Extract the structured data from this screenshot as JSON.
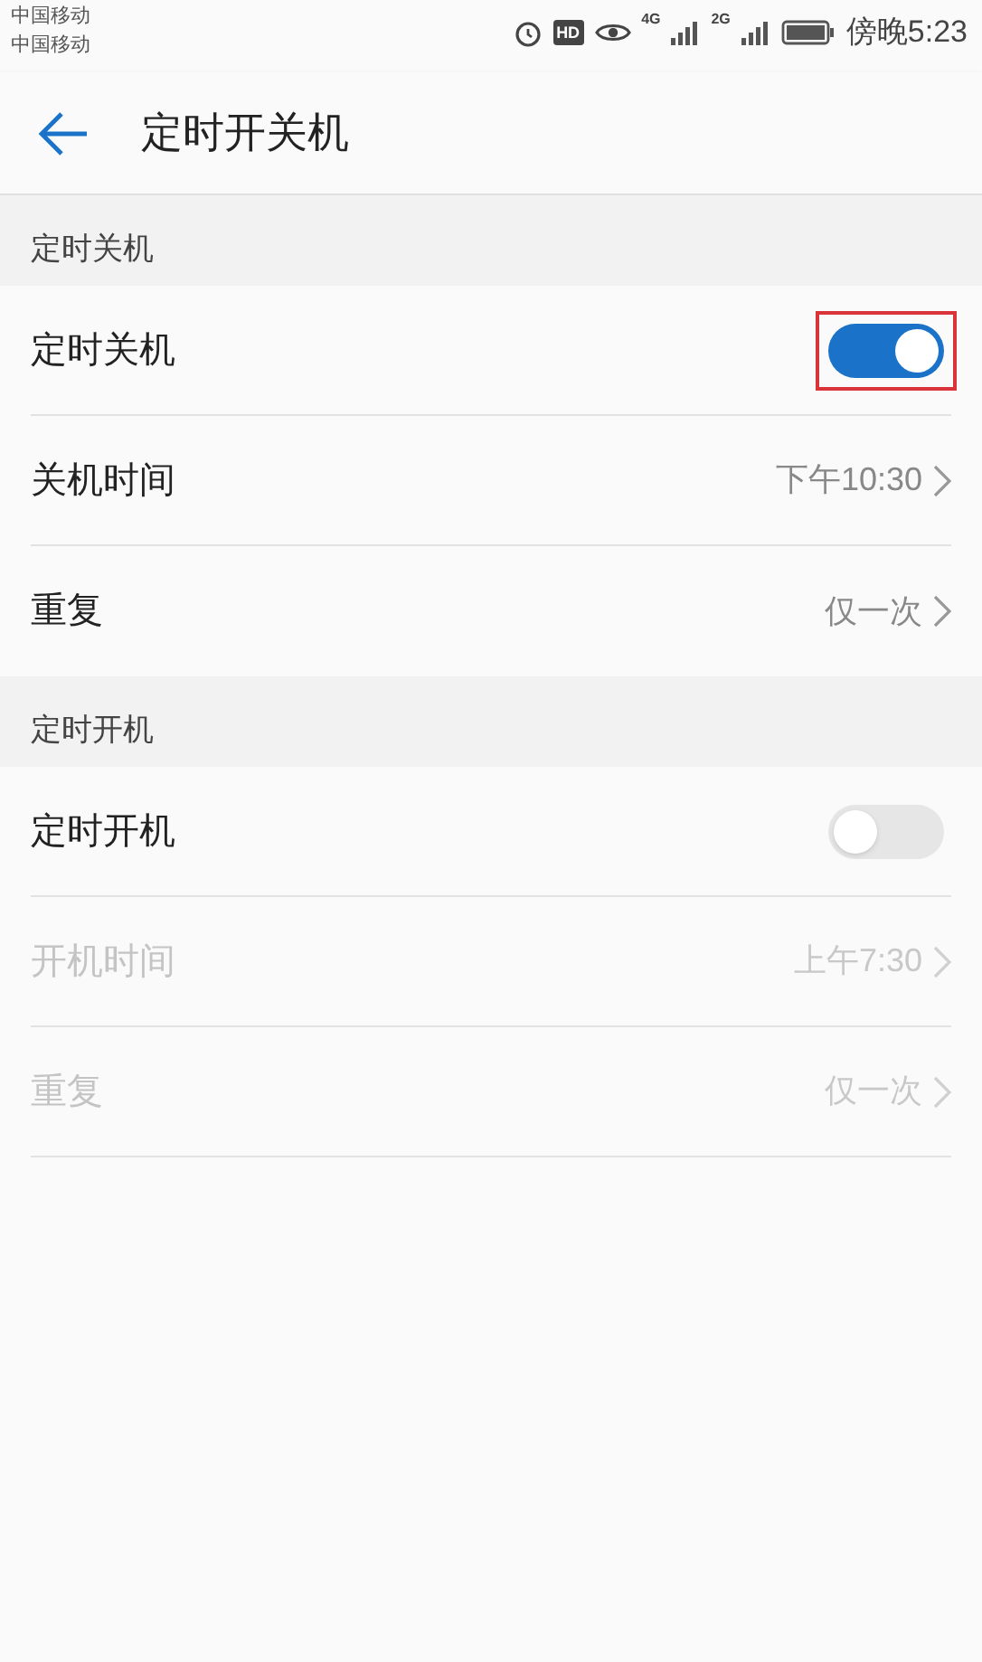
{
  "status_bar": {
    "carriers": [
      "中国移动",
      "中国移动"
    ],
    "hd": "HD",
    "net1": "4G",
    "net2": "2G",
    "time": "傍晚5:23"
  },
  "header": {
    "title": "定时开关机"
  },
  "sections": [
    {
      "title": "定时关机",
      "rows": [
        {
          "kind": "switch",
          "label": "定时关机",
          "on": true,
          "highlighted": true
        },
        {
          "kind": "value",
          "label": "关机时间",
          "value": "下午10:30",
          "disabled": false
        },
        {
          "kind": "value",
          "label": "重复",
          "value": "仅一次",
          "disabled": false
        }
      ]
    },
    {
      "title": "定时开机",
      "rows": [
        {
          "kind": "switch",
          "label": "定时开机",
          "on": false,
          "highlighted": false
        },
        {
          "kind": "value",
          "label": "开机时间",
          "value": "上午7:30",
          "disabled": true
        },
        {
          "kind": "value",
          "label": "重复",
          "value": "仅一次",
          "disabled": true
        }
      ]
    }
  ]
}
